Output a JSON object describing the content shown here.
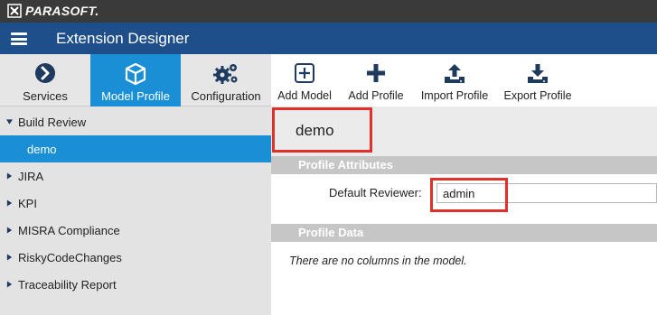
{
  "brand": {
    "name": "PARASOFT.",
    "logo_icon": "parasoft-logo-icon"
  },
  "header": {
    "title": "Extension Designer",
    "menu_icon": "hamburger-menu-icon"
  },
  "tabs": [
    {
      "label": "Services",
      "icon": "chevron-right-circle-icon",
      "active": false
    },
    {
      "label": "Model Profile",
      "icon": "cube-icon",
      "active": true
    },
    {
      "label": "Configuration",
      "icon": "gears-icon",
      "active": false
    }
  ],
  "toolbar": {
    "add_model": "Add Model",
    "add_profile": "Add Profile",
    "import_profile": "Import Profile",
    "export_profile": "Export Profile"
  },
  "sidebar": {
    "items": [
      {
        "label": "Build Review",
        "expanded": true
      },
      {
        "label": "demo",
        "selected": true
      },
      {
        "label": "JIRA"
      },
      {
        "label": "KPI"
      },
      {
        "label": "MISRA Compliance"
      },
      {
        "label": "RiskyCodeChanges"
      },
      {
        "label": "Traceability Report"
      }
    ]
  },
  "main": {
    "title": "demo",
    "profile_attributes_header": "Profile Attributes",
    "default_reviewer_label": "Default Reviewer:",
    "default_reviewer_value": "admin",
    "profile_data_header": "Profile Data",
    "empty_message": "There are no columns in the model."
  },
  "colors": {
    "brand_bar": "#3a3a3a",
    "title_bar": "#1f4f8a",
    "accent_blue": "#1b8fd6",
    "highlight_red": "#e0302a",
    "sidebar_bg": "#e3e3e3",
    "section_header": "#c6c6c6",
    "icon_dark": "#1e3a5f"
  }
}
